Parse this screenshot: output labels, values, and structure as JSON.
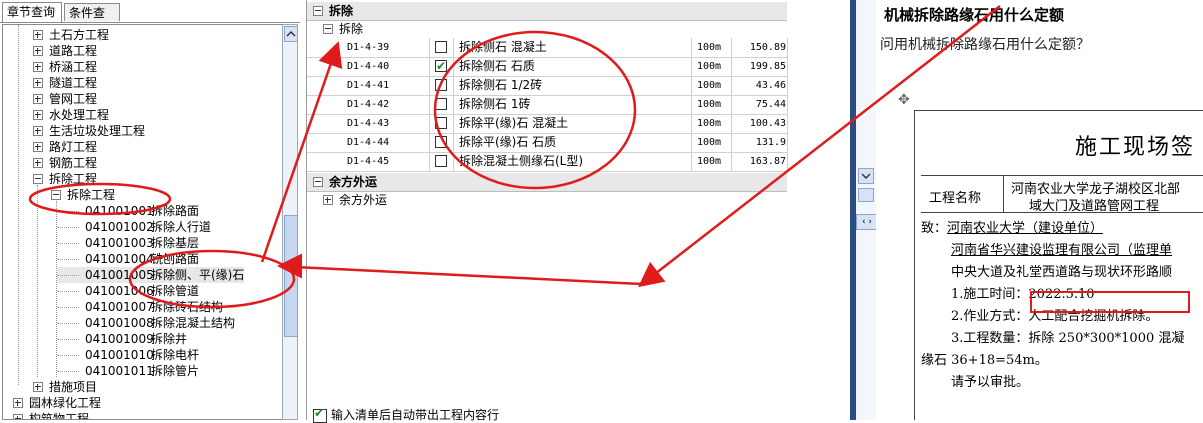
{
  "left": {
    "tabs": [
      "章节查询",
      "条件查询"
    ],
    "tree_top": [
      {
        "label": "土石方工程",
        "expanded": false
      },
      {
        "label": "道路工程",
        "expanded": false
      },
      {
        "label": "桥涵工程",
        "expanded": false
      },
      {
        "label": "隧道工程",
        "expanded": false
      },
      {
        "label": "管网工程",
        "expanded": false
      },
      {
        "label": "水处理工程",
        "expanded": false
      },
      {
        "label": "生活垃圾处理工程",
        "expanded": false
      },
      {
        "label": "路灯工程",
        "expanded": false
      },
      {
        "label": "钢筋工程",
        "expanded": false
      },
      {
        "label": "拆除工程",
        "expanded": true
      }
    ],
    "subnode": "拆除工程",
    "leaves": [
      {
        "code": "041001001",
        "label": "拆除路面"
      },
      {
        "code": "041001002",
        "label": "拆除人行道"
      },
      {
        "code": "041001003",
        "label": "拆除基层"
      },
      {
        "code": "041001004",
        "label": "铣刨路面"
      },
      {
        "code": "041001005",
        "label": "拆除侧、平(缘)石"
      },
      {
        "code": "041001006",
        "label": "拆除管道"
      },
      {
        "code": "041001007",
        "label": "拆除砖石结构"
      },
      {
        "code": "041001008",
        "label": "拆除混凝土结构"
      },
      {
        "code": "041001009",
        "label": "拆除井"
      },
      {
        "code": "041001010",
        "label": "拆除电杆"
      },
      {
        "code": "041001011",
        "label": "拆除管片"
      }
    ],
    "tree_bottom": [
      {
        "label": "措施项目",
        "level": 1
      },
      {
        "label": "园林绿化工程",
        "level": 0
      },
      {
        "label": "构筑物工程",
        "level": 0
      }
    ]
  },
  "mid": {
    "group1": "拆除",
    "sub1": "拆除",
    "rows": [
      {
        "code": "D1-4-39",
        "checked": false,
        "name": "拆除侧石 混凝土",
        "unit": "100m",
        "value": "150.89"
      },
      {
        "code": "D1-4-40",
        "checked": true,
        "name": "拆除侧石 石质",
        "unit": "100m",
        "value": "199.85"
      },
      {
        "code": "D1-4-41",
        "checked": false,
        "name": "拆除侧石 1/2砖",
        "unit": "100m",
        "value": "43.46"
      },
      {
        "code": "D1-4-42",
        "checked": false,
        "name": "拆除侧石 1砖",
        "unit": "100m",
        "value": "75.44"
      },
      {
        "code": "D1-4-43",
        "checked": false,
        "name": "拆除平(缘)石 混凝土",
        "unit": "100m",
        "value": "100.43"
      },
      {
        "code": "D1-4-44",
        "checked": false,
        "name": "拆除平(缘)石 石质",
        "unit": "100m",
        "value": "131.9"
      },
      {
        "code": "D1-4-45",
        "checked": false,
        "name": "拆除混凝土侧缘石(L型)",
        "unit": "100m",
        "value": "163.87"
      }
    ],
    "group2": "余方外运",
    "sub2": "余方外运",
    "bottom_option": "输入清单后自动带出工程内容行"
  },
  "right": {
    "question_title": "机械拆除路缘石用什么定额",
    "question_text": "问用机械拆除路缘石用什么定额？",
    "doc_title": "施工现场签",
    "name_label": "工程名称",
    "name_value_1": "河南农业大学龙子湖校区北部",
    "name_value_2": "域大门及道路管网工程",
    "line_to": "致：",
    "line_to_unit": "河南农业大学（建设单位）",
    "line_supervisor": "河南省华兴建设监理有限公司（监理单",
    "line_location": "中央大道及礼堂西道路与现状环形路顺",
    "line_time": "1.施工时间：2022.5.10",
    "line_method_label": "2.作业方式：",
    "line_method_value": "人工配合挖掘机拆除。",
    "line_quantity": "3.工程数量：拆除 250*300*1000 混凝",
    "line_curb": "缘石 36+18=54m。",
    "line_request": "请予以审批。"
  }
}
